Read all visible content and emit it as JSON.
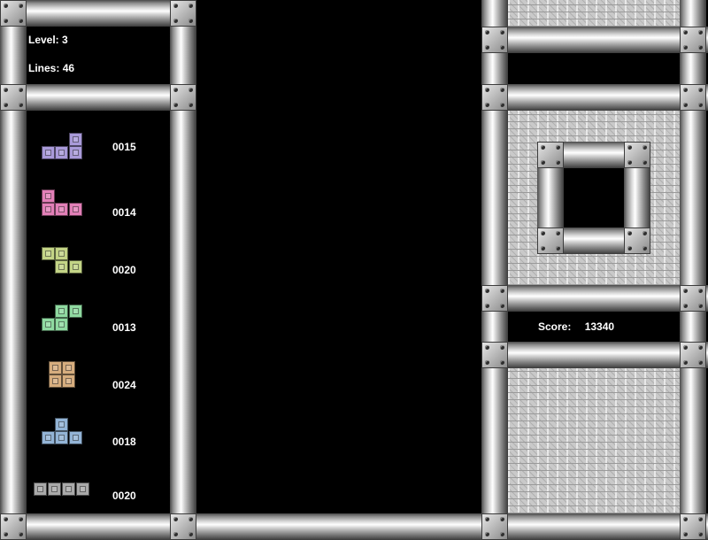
{
  "info": {
    "level_label": "Level:",
    "level_value": "3",
    "lines_label": "Lines:",
    "lines_value": "46"
  },
  "score": {
    "label": "Score:",
    "value": "13340"
  },
  "statistics": [
    {
      "piece": "T",
      "count": "0015",
      "color": "#a99ad9"
    },
    {
      "piece": "J",
      "count": "0014",
      "color": "#e27fb7"
    },
    {
      "piece": "Z",
      "count": "0020",
      "color": "#c3d486"
    },
    {
      "piece": "S",
      "count": "0013",
      "color": "#8fd9a0"
    },
    {
      "piece": "O",
      "count": "0024",
      "color": "#d6ad7e"
    },
    {
      "piece": "T-up",
      "count": "0018",
      "color": "#93b4d6"
    },
    {
      "piece": "I",
      "count": "0020",
      "color": "#a9a9a9"
    }
  ],
  "colors": {
    "background": "#000000",
    "text": "#ffffff"
  }
}
